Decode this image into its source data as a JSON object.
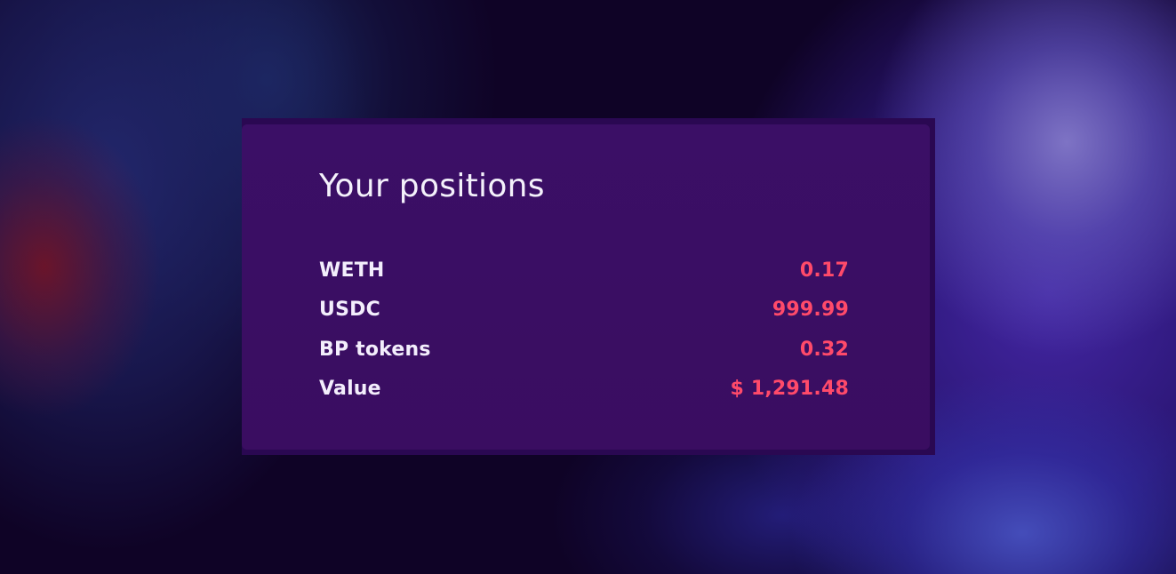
{
  "card": {
    "title": "Your positions",
    "positions": [
      {
        "label": "WETH",
        "value": "0.17"
      },
      {
        "label": "USDC",
        "value": "999.99"
      },
      {
        "label": "BP tokens",
        "value": "0.32"
      },
      {
        "label": "Value",
        "value": "$ 1,291.48"
      }
    ]
  },
  "colors": {
    "label_text": "#f3eefc",
    "value_text": "#ff4a6a",
    "card_background": "#3b0f66",
    "card_border": "#2a0852"
  }
}
